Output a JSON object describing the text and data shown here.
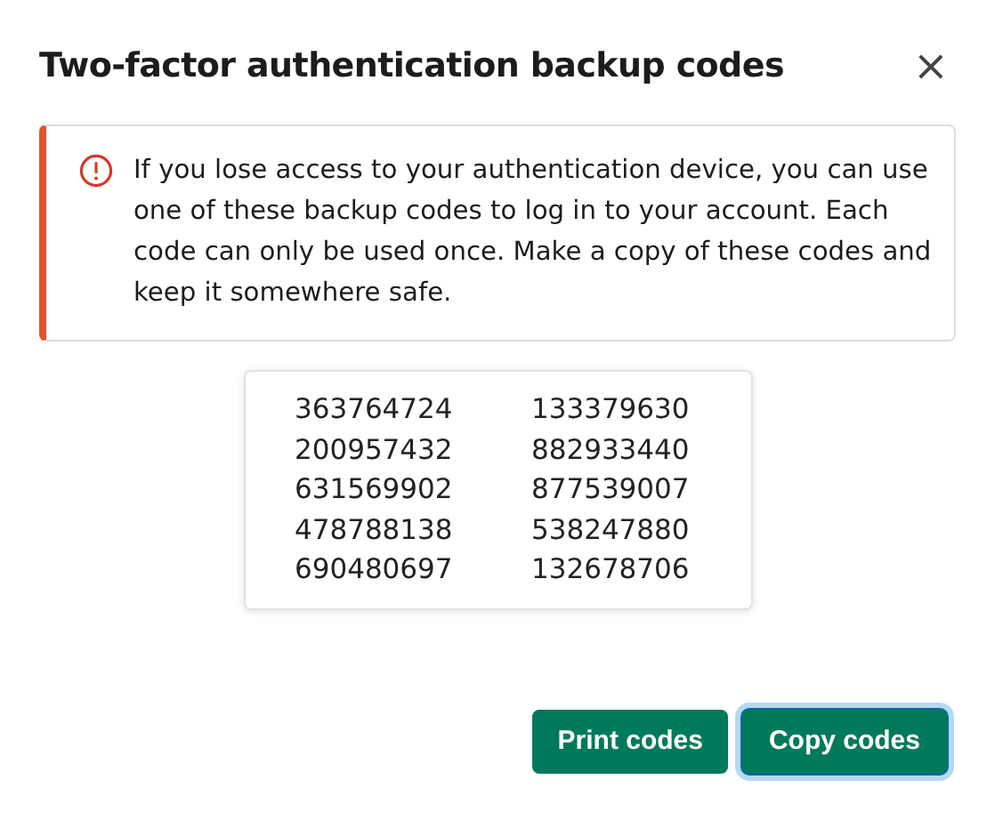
{
  "dialog": {
    "title": "Two-factor authentication backup codes",
    "close": "×"
  },
  "alert": {
    "text": "If you lose access to your authentication device, you can use one of these backup codes to log in to your account. Each code can only be used once. Make a copy of these codes and keep it somewhere safe."
  },
  "codes": [
    [
      "363764724",
      "133379630"
    ],
    [
      "200957432",
      "882933440"
    ],
    [
      "631569902",
      "877539007"
    ],
    [
      "478788138",
      "538247880"
    ],
    [
      "690480697",
      "132678706"
    ]
  ],
  "buttons": [
    {
      "label": "Print codes",
      "focused": false
    },
    {
      "label": "Copy codes",
      "focused": true
    }
  ]
}
